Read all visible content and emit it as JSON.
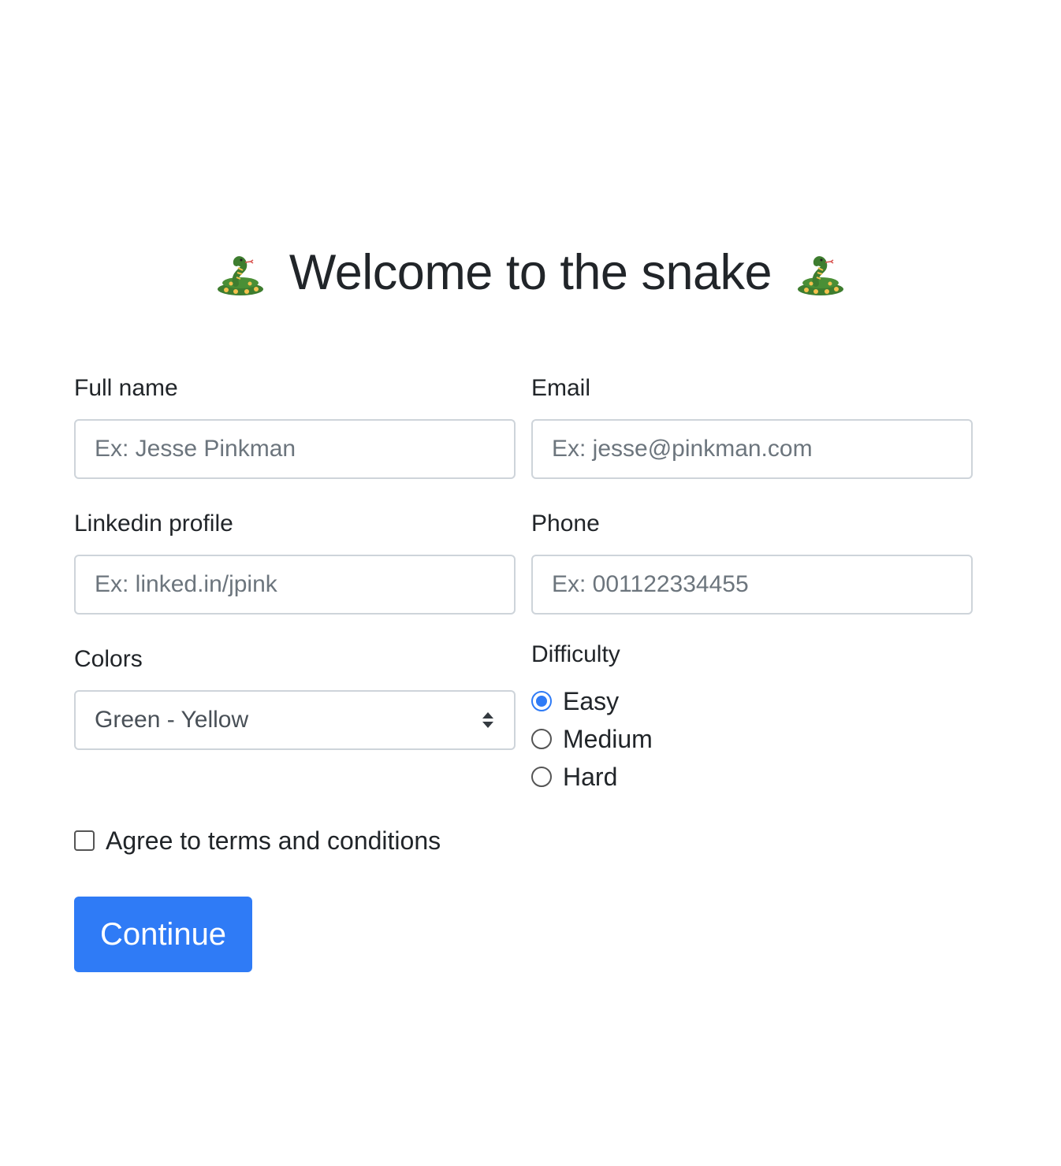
{
  "header": {
    "title": "Welcome to the snake",
    "left_icon": "snake-icon",
    "right_icon": "snake-icon"
  },
  "form": {
    "full_name": {
      "label": "Full name",
      "value": "",
      "placeholder": "Ex: Jesse Pinkman"
    },
    "email": {
      "label": "Email",
      "value": "",
      "placeholder": "Ex: jesse@pinkman.com"
    },
    "linkedin": {
      "label": "Linkedin profile",
      "value": "",
      "placeholder": "Ex: linked.in/jpink"
    },
    "phone": {
      "label": "Phone",
      "value": "",
      "placeholder": "Ex: 001122334455"
    },
    "colors": {
      "label": "Colors",
      "selected": "Green - Yellow"
    },
    "difficulty": {
      "label": "Difficulty",
      "options": [
        {
          "label": "Easy",
          "checked": true
        },
        {
          "label": "Medium",
          "checked": false
        },
        {
          "label": "Hard",
          "checked": false
        }
      ]
    },
    "terms": {
      "label": "Agree to terms and conditions",
      "checked": false
    },
    "submit_label": "Continue"
  },
  "colors": {
    "primary": "#2f7bf6",
    "input_border": "#ced4da",
    "placeholder": "#6c757d",
    "text": "#212529",
    "snake_green": "#3e7d2f",
    "snake_yellow": "#f4c14e"
  }
}
